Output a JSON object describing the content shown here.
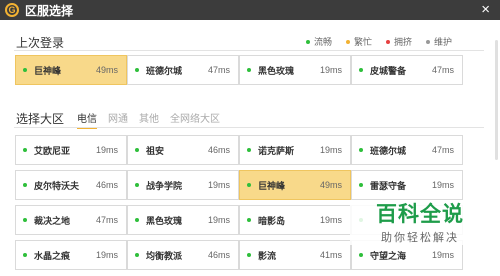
{
  "window": {
    "title": "区服选择",
    "logo_letter": "G",
    "close_glyph": "×"
  },
  "recent": {
    "heading": "上次登录",
    "servers": [
      {
        "name": "巨神峰",
        "ping": "49ms",
        "selected": true
      },
      {
        "name": "班德尔城",
        "ping": "47ms",
        "selected": false
      },
      {
        "name": "黑色玫瑰",
        "ping": "19ms",
        "selected": false
      },
      {
        "name": "皮城警备",
        "ping": "47ms",
        "selected": false
      }
    ]
  },
  "legend": {
    "items": [
      {
        "label": "流畅",
        "color": "#2fbf3c"
      },
      {
        "label": "繁忙",
        "color": "#f2b233"
      },
      {
        "label": "拥挤",
        "color": "#e64040"
      },
      {
        "label": "维护",
        "color": "#999999"
      }
    ]
  },
  "region": {
    "heading": "选择大区",
    "tabs": [
      "电信",
      "网通",
      "其他",
      "全网络大区"
    ],
    "active_tab": 0,
    "servers": [
      {
        "name": "艾欧尼亚",
        "ping": "19ms",
        "selected": false
      },
      {
        "name": "祖安",
        "ping": "46ms",
        "selected": false
      },
      {
        "name": "诺克萨斯",
        "ping": "19ms",
        "selected": false
      },
      {
        "name": "班德尔城",
        "ping": "47ms",
        "selected": false
      },
      {
        "name": "皮尔特沃夫",
        "ping": "46ms",
        "selected": false
      },
      {
        "name": "战争学院",
        "ping": "19ms",
        "selected": false
      },
      {
        "name": "巨神峰",
        "ping": "49ms",
        "selected": true
      },
      {
        "name": "雷瑟守备",
        "ping": "19ms",
        "selected": false
      },
      {
        "name": "裁决之地",
        "ping": "47ms",
        "selected": false
      },
      {
        "name": "黑色玫瑰",
        "ping": "19ms",
        "selected": false
      },
      {
        "name": "暗影岛",
        "ping": "19ms",
        "selected": false
      },
      {
        "name": "",
        "ping": "",
        "selected": false
      },
      {
        "name": "水晶之痕",
        "ping": "19ms",
        "selected": false
      },
      {
        "name": "均衡教派",
        "ping": "46ms",
        "selected": false
      },
      {
        "name": "影流",
        "ping": "41ms",
        "selected": false
      },
      {
        "name": "守望之海",
        "ping": "19ms",
        "selected": false
      }
    ]
  },
  "watermark": {
    "big": "百科全说",
    "small": "助你轻松解决"
  }
}
